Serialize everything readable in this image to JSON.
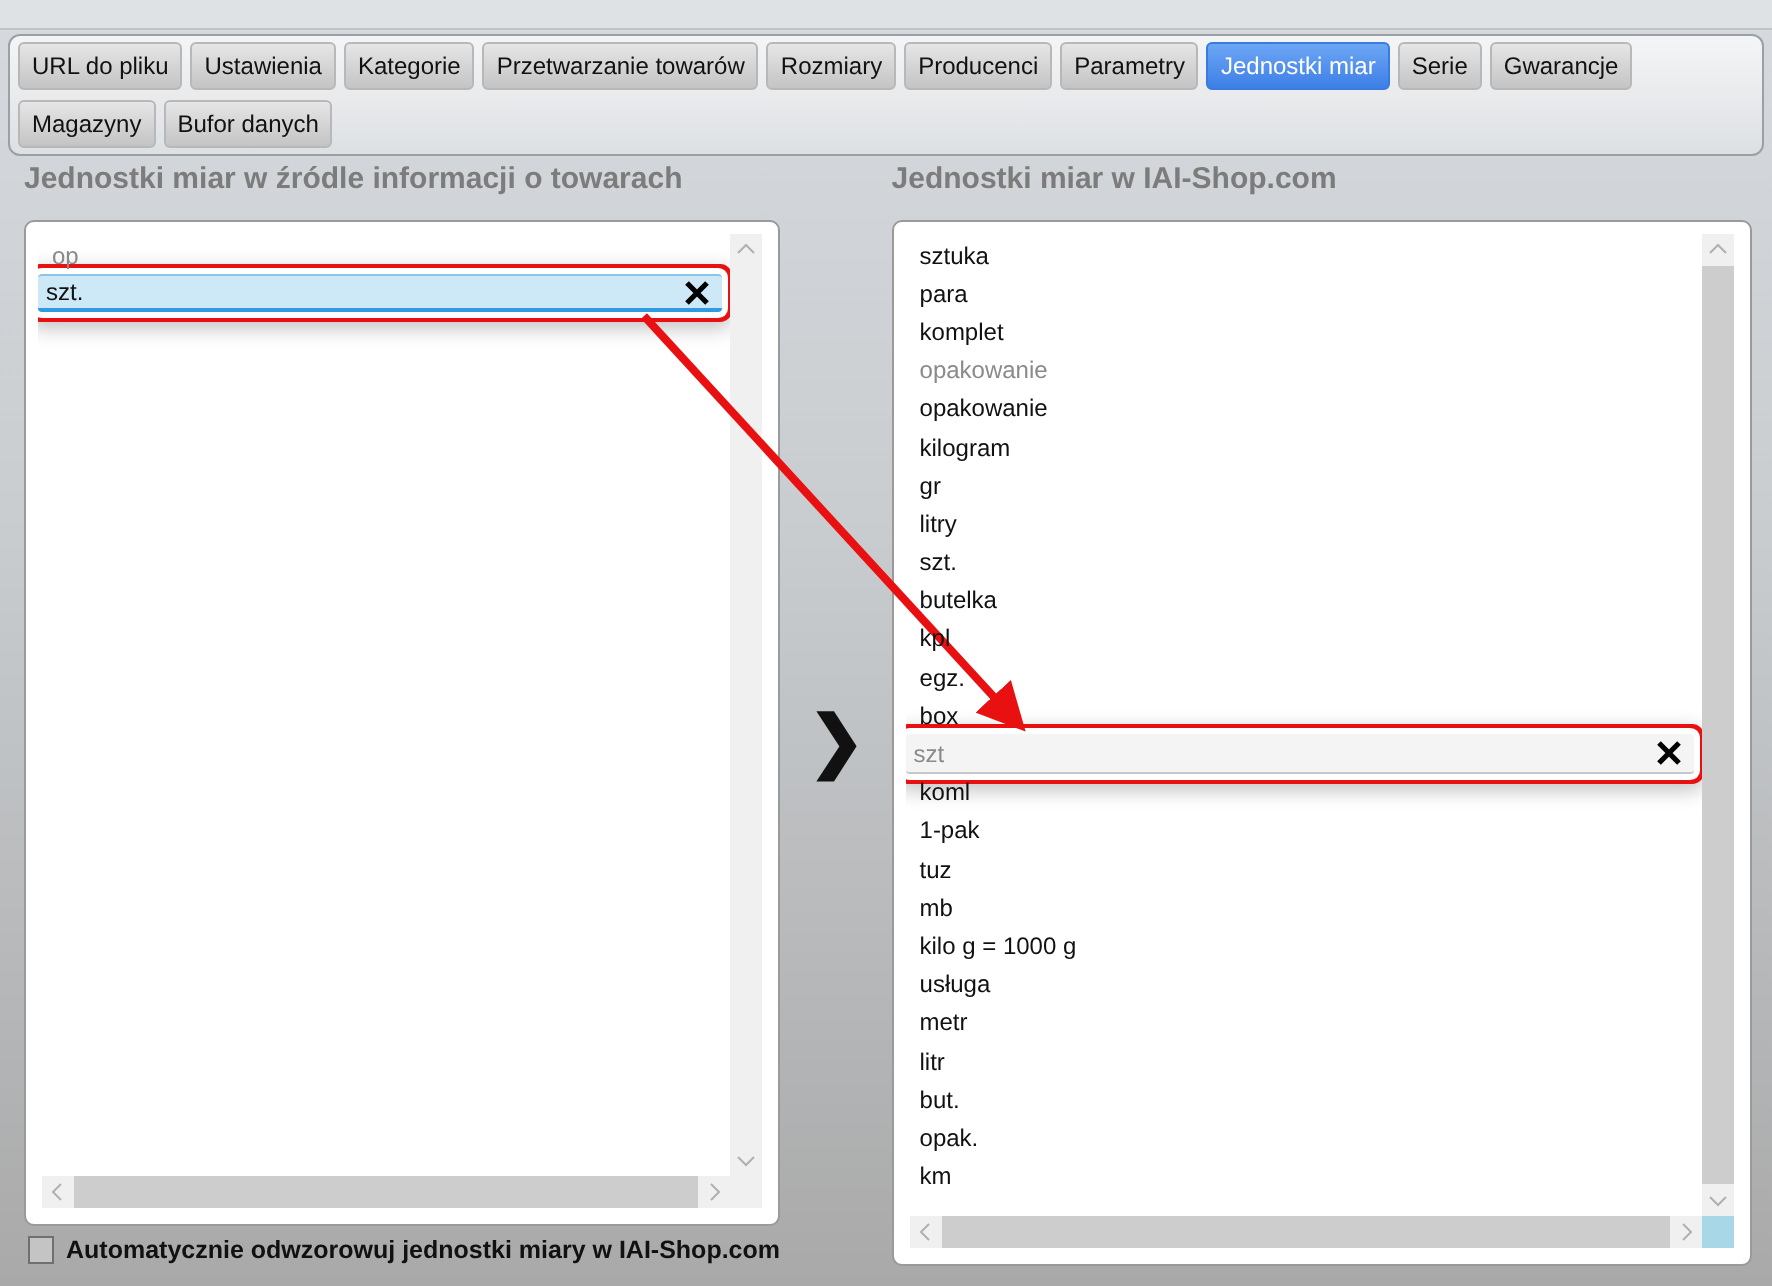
{
  "tabs": [
    {
      "label": "URL do pliku",
      "selected": false
    },
    {
      "label": "Ustawienia",
      "selected": false
    },
    {
      "label": "Kategorie",
      "selected": false
    },
    {
      "label": "Przetwarzanie towarów",
      "selected": false
    },
    {
      "label": "Rozmiary",
      "selected": false
    },
    {
      "label": "Producenci",
      "selected": false
    },
    {
      "label": "Parametry",
      "selected": false
    },
    {
      "label": "Jednostki miar",
      "selected": true
    },
    {
      "label": "Serie",
      "selected": false
    },
    {
      "label": "Gwarancje",
      "selected": false
    },
    {
      "label": "Magazyny",
      "selected": false
    },
    {
      "label": "Bufor danych",
      "selected": false
    }
  ],
  "source_panel": {
    "title": "Jednostki miar w źródle informacji o towarach",
    "items": [
      {
        "text": "op",
        "kind": "plain",
        "disabled": true,
        "selected": false,
        "highlighted": false
      },
      {
        "text": "szt.",
        "kind": "mapped",
        "disabled": false,
        "selected": true,
        "highlighted": true
      }
    ]
  },
  "map_arrow": "❯",
  "target_panel": {
    "title": "Jednostki miar w IAI-Shop.com",
    "items": [
      {
        "text": "sztuka",
        "kind": "plain",
        "disabled": false,
        "selected": false,
        "highlighted": false
      },
      {
        "text": "para",
        "kind": "plain",
        "disabled": false,
        "selected": false,
        "highlighted": false
      },
      {
        "text": "komplet",
        "kind": "plain",
        "disabled": false,
        "selected": false,
        "highlighted": false
      },
      {
        "text": "opakowanie",
        "kind": "plain",
        "disabled": true,
        "selected": false,
        "highlighted": false
      },
      {
        "text": "opakowanie",
        "kind": "plain",
        "disabled": false,
        "selected": false,
        "highlighted": false
      },
      {
        "text": "kilogram",
        "kind": "plain",
        "disabled": false,
        "selected": false,
        "highlighted": false
      },
      {
        "text": "gr",
        "kind": "plain",
        "disabled": false,
        "selected": false,
        "highlighted": false
      },
      {
        "text": "litry",
        "kind": "plain",
        "disabled": false,
        "selected": false,
        "highlighted": false
      },
      {
        "text": "szt.",
        "kind": "plain",
        "disabled": false,
        "selected": false,
        "highlighted": false
      },
      {
        "text": "butelka",
        "kind": "plain",
        "disabled": false,
        "selected": false,
        "highlighted": false
      },
      {
        "text": "kpl",
        "kind": "plain",
        "disabled": false,
        "selected": false,
        "highlighted": false
      },
      {
        "text": "egz.",
        "kind": "plain",
        "disabled": false,
        "selected": false,
        "highlighted": false
      },
      {
        "text": "box",
        "kind": "plain",
        "disabled": false,
        "selected": false,
        "highlighted": false
      },
      {
        "text": "szt",
        "kind": "mapped",
        "disabled": true,
        "selected": false,
        "highlighted": true
      },
      {
        "text": "koml",
        "kind": "plain",
        "disabled": false,
        "selected": false,
        "highlighted": false
      },
      {
        "text": "1-pak",
        "kind": "plain",
        "disabled": false,
        "selected": false,
        "highlighted": false
      },
      {
        "text": "tuz",
        "kind": "plain",
        "disabled": false,
        "selected": false,
        "highlighted": false
      },
      {
        "text": "mb",
        "kind": "plain",
        "disabled": false,
        "selected": false,
        "highlighted": false
      },
      {
        "text": "kilo g = 1000 g",
        "kind": "plain",
        "disabled": false,
        "selected": false,
        "highlighted": false
      },
      {
        "text": "usługa",
        "kind": "plain",
        "disabled": false,
        "selected": false,
        "highlighted": false
      },
      {
        "text": "metr",
        "kind": "plain",
        "disabled": false,
        "selected": false,
        "highlighted": false
      },
      {
        "text": "litr",
        "kind": "plain",
        "disabled": false,
        "selected": false,
        "highlighted": false
      },
      {
        "text": "but.",
        "kind": "plain",
        "disabled": false,
        "selected": false,
        "highlighted": false
      },
      {
        "text": "opak.",
        "kind": "plain",
        "disabled": false,
        "selected": false,
        "highlighted": false
      },
      {
        "text": "km",
        "kind": "plain",
        "disabled": false,
        "selected": false,
        "highlighted": false
      }
    ]
  },
  "auto_map": {
    "label": "Automatycznie odwzorowuj jednostki miary w IAI-Shop.com",
    "checked": false
  }
}
